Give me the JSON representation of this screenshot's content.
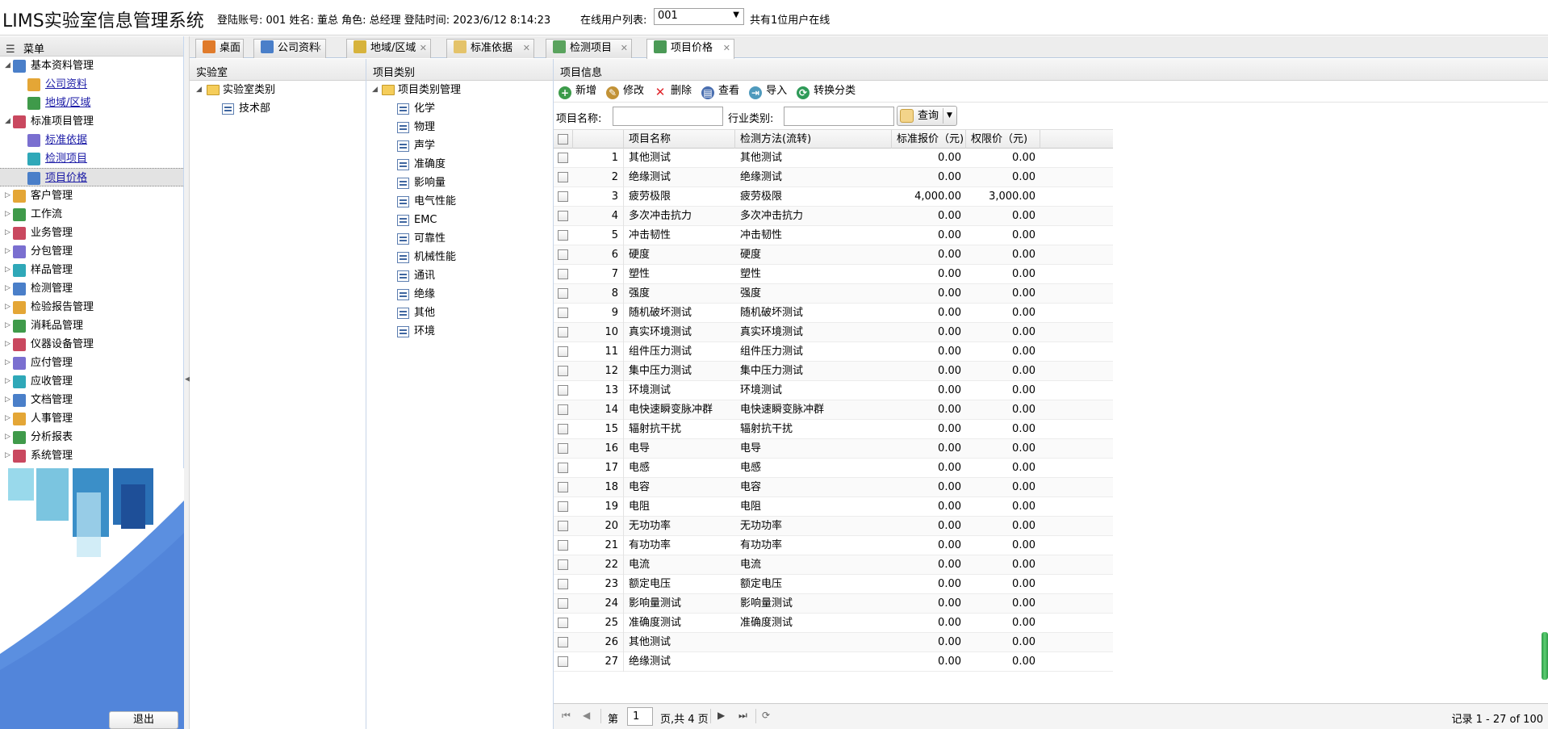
{
  "app_title": "LIMS实验室信息管理系统",
  "login_info": "登陆账号: 001 姓名: 董总 角色: 总经理 登陆时间: 2023/6/12 8:14:23",
  "online_list_label": "在线用户列表:",
  "online_select_value": "001",
  "online_count": "共有1位用户在线",
  "menu_title": "菜单",
  "menu": [
    {
      "label": "基本资料管理",
      "expanded": true,
      "level": 0,
      "link": false
    },
    {
      "label": "公司资料",
      "level": 1,
      "link": true
    },
    {
      "label": "地域/区域",
      "level": 1,
      "link": true
    },
    {
      "label": "标准项目管理",
      "expanded": true,
      "level": 0,
      "link": false
    },
    {
      "label": "标准依据",
      "level": 1,
      "link": true
    },
    {
      "label": "检测项目",
      "level": 1,
      "link": true
    },
    {
      "label": "项目价格",
      "level": 1,
      "link": true,
      "selected": true
    },
    {
      "label": "客户管理",
      "level": 0,
      "link": false
    },
    {
      "label": "工作流",
      "level": 0,
      "link": false
    },
    {
      "label": "业务管理",
      "level": 0,
      "link": false
    },
    {
      "label": "分包管理",
      "level": 0,
      "link": false
    },
    {
      "label": "样品管理",
      "level": 0,
      "link": false
    },
    {
      "label": "检测管理",
      "level": 0,
      "link": false
    },
    {
      "label": "检验报告管理",
      "level": 0,
      "link": false
    },
    {
      "label": "消耗品管理",
      "level": 0,
      "link": false
    },
    {
      "label": "仪器设备管理",
      "level": 0,
      "link": false
    },
    {
      "label": "应付管理",
      "level": 0,
      "link": false
    },
    {
      "label": "应收管理",
      "level": 0,
      "link": false
    },
    {
      "label": "文档管理",
      "level": 0,
      "link": false
    },
    {
      "label": "人事管理",
      "level": 0,
      "link": false
    },
    {
      "label": "分析报表",
      "level": 0,
      "link": false
    },
    {
      "label": "系统管理",
      "level": 0,
      "link": false
    }
  ],
  "logout_label": "退出",
  "tabs": [
    {
      "label": "桌面",
      "closable": false
    },
    {
      "label": "公司资料",
      "closable": true
    },
    {
      "label": "地域/区域",
      "closable": true
    },
    {
      "label": "标准依据",
      "closable": true
    },
    {
      "label": "检测项目",
      "closable": true
    },
    {
      "label": "项目价格",
      "closable": true,
      "active": true
    }
  ],
  "lab_panel": {
    "title": "实验室",
    "root": "实验室类别",
    "children": [
      "技术部"
    ]
  },
  "category_panel": {
    "title": "项目类别",
    "root": "项目类别管理",
    "children": [
      "化学",
      "物理",
      "声学",
      "准确度",
      "影响量",
      "电气性能",
      "EMC",
      "可靠性",
      "机械性能",
      "通讯",
      "绝缘",
      "其他",
      "环境"
    ]
  },
  "info_panel": {
    "title": "项目信息",
    "toolbar": [
      {
        "label": "新增",
        "icon": "add-icon"
      },
      {
        "label": "修改",
        "icon": "edit-icon"
      },
      {
        "label": "删除",
        "icon": "delete-icon"
      },
      {
        "label": "查看",
        "icon": "view-icon"
      },
      {
        "label": "导入",
        "icon": "import-icon"
      },
      {
        "label": "转换分类",
        "icon": "convert-icon"
      }
    ],
    "search": {
      "name_label": "项目名称:",
      "name_value": "",
      "industry_label": "行业类别:",
      "industry_value": "",
      "query_label": "查询"
    },
    "columns": [
      "项目名称",
      "检测方法(流转)",
      "标准报价（元)",
      "权限价（元)"
    ],
    "rows": [
      [
        "1",
        "其他测试",
        "其他测试",
        "0.00",
        "0.00"
      ],
      [
        "2",
        "绝缘测试",
        "绝缘测试",
        "0.00",
        "0.00"
      ],
      [
        "3",
        "疲劳极限",
        "疲劳极限",
        "4,000.00",
        "3,000.00"
      ],
      [
        "4",
        "多次冲击抗力",
        "多次冲击抗力",
        "0.00",
        "0.00"
      ],
      [
        "5",
        "冲击韧性",
        "冲击韧性",
        "0.00",
        "0.00"
      ],
      [
        "6",
        "硬度",
        "硬度",
        "0.00",
        "0.00"
      ],
      [
        "7",
        "塑性",
        "塑性",
        "0.00",
        "0.00"
      ],
      [
        "8",
        "强度",
        "强度",
        "0.00",
        "0.00"
      ],
      [
        "9",
        "随机破坏测试",
        "随机破坏测试",
        "0.00",
        "0.00"
      ],
      [
        "10",
        "真实环境测试",
        "真实环境测试",
        "0.00",
        "0.00"
      ],
      [
        "11",
        "组件压力测试",
        "组件压力测试",
        "0.00",
        "0.00"
      ],
      [
        "12",
        "集中压力测试",
        "集中压力测试",
        "0.00",
        "0.00"
      ],
      [
        "13",
        "环境测试",
        "环境测试",
        "0.00",
        "0.00"
      ],
      [
        "14",
        "电快速瞬变脉冲群",
        "电快速瞬变脉冲群",
        "0.00",
        "0.00"
      ],
      [
        "15",
        "辐射抗干扰",
        "辐射抗干扰",
        "0.00",
        "0.00"
      ],
      [
        "16",
        "电导",
        "电导",
        "0.00",
        "0.00"
      ],
      [
        "17",
        "电感",
        "电感",
        "0.00",
        "0.00"
      ],
      [
        "18",
        "电容",
        "电容",
        "0.00",
        "0.00"
      ],
      [
        "19",
        "电阻",
        "电阻",
        "0.00",
        "0.00"
      ],
      [
        "20",
        "无功功率",
        "无功功率",
        "0.00",
        "0.00"
      ],
      [
        "21",
        "有功功率",
        "有功功率",
        "0.00",
        "0.00"
      ],
      [
        "22",
        "电流",
        "电流",
        "0.00",
        "0.00"
      ],
      [
        "23",
        "额定电压",
        "额定电压",
        "0.00",
        "0.00"
      ],
      [
        "24",
        "影响量测试",
        "影响量测试",
        "0.00",
        "0.00"
      ],
      [
        "25",
        "准确度测试",
        "准确度测试",
        "0.00",
        "0.00"
      ],
      [
        "26",
        "其他测试",
        "",
        "0.00",
        "0.00"
      ],
      [
        "27",
        "绝缘测试",
        "",
        "0.00",
        "0.00"
      ]
    ],
    "pager": {
      "page_prefix": "第",
      "page_value": "1",
      "page_suffix": "页,共 4 页",
      "record_info": "记录 1 - 27 of 100"
    }
  },
  "colors": {
    "link": "#1a1aa6",
    "accent_blue": "#5b8fe0",
    "scrollbar_green": "#3db85a"
  }
}
